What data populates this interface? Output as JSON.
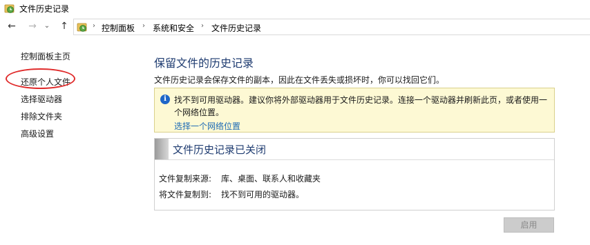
{
  "window": {
    "title": "文件历史记录"
  },
  "nav": {
    "back_icon": "←",
    "forward_icon": "→",
    "recent_icon": "⌄",
    "up_icon": "↑",
    "breadcrumb": [
      "控制面板",
      "系统和安全",
      "文件历史记录"
    ],
    "separator_icon": "›"
  },
  "sidebar": {
    "items": [
      {
        "label": "控制面板主页"
      },
      {
        "label": "还原个人文件"
      },
      {
        "label": "选择驱动器"
      },
      {
        "label": "排除文件夹"
      },
      {
        "label": "高级设置"
      }
    ],
    "highlight_color": "#e02b2b"
  },
  "main": {
    "title": "保留文件的历史记录",
    "description": "文件历史记录会保存文件的副本，因此在文件丢失或损坏时，你可以找回它们。"
  },
  "info": {
    "icon": "i",
    "message": "找不到可用驱动器。建议你将外部驱动器用于文件历史记录。连接一个驱动器并刷新此页，或者使用一个网络位置。",
    "link": "选择一个网络位置"
  },
  "status": {
    "title": "文件历史记录已关闭",
    "copy_from_label": "文件复制来源:",
    "copy_from_value": "库、桌面、联系人和收藏夹",
    "copy_to_label": "将文件复制到:",
    "copy_to_value": "找不到可用的驱动器。"
  },
  "actions": {
    "enable_label": "启用"
  },
  "colors": {
    "title_blue": "#1e3b70",
    "link_blue": "#1c6ab5",
    "info_bg": "#fdf9d4"
  }
}
